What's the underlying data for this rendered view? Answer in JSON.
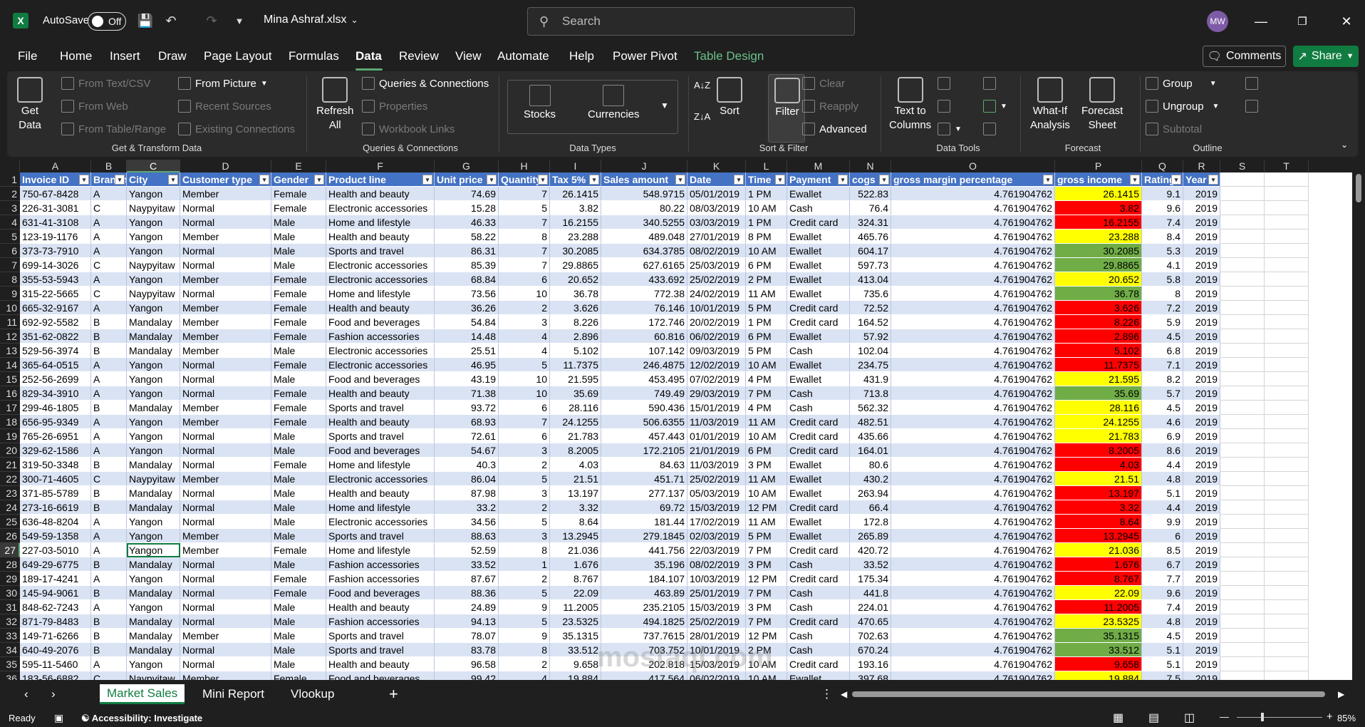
{
  "titlebar": {
    "logo": "X",
    "autosave_label": "AutoSave",
    "autosave_state": "Off",
    "filename": "Mina Ashraf.xlsx",
    "search_placeholder": "Search",
    "avatar": "MW"
  },
  "menu": [
    "File",
    "Home",
    "Insert",
    "Draw",
    "Page Layout",
    "Formulas",
    "Data",
    "Review",
    "View",
    "Automate",
    "Help",
    "Power Pivot",
    "Table Design"
  ],
  "menu_active": "Data",
  "buttons": {
    "comments": "Comments",
    "share": "Share"
  },
  "ribbon": {
    "get_data": "Get\nData",
    "from_text": "From Text/CSV",
    "from_web": "From Web",
    "from_table": "From Table/Range",
    "from_picture": "From Picture",
    "recent_sources": "Recent Sources",
    "existing_connections": "Existing Connections",
    "group_get": "Get & Transform Data",
    "refresh": "Refresh\nAll",
    "queries_connections": "Queries & Connections",
    "properties": "Properties",
    "workbook_links": "Workbook Links",
    "group_queries": "Queries & Connections",
    "stocks": "Stocks",
    "currencies": "Currencies",
    "group_datatypes": "Data Types",
    "sort": "Sort",
    "filter": "Filter",
    "clear": "Clear",
    "reapply": "Reapply",
    "advanced": "Advanced",
    "group_sortfilter": "Sort & Filter",
    "text_to_columns": "Text to\nColumns",
    "group_datatools": "Data Tools",
    "whatif": "What-If\nAnalysis",
    "forecast_sheet": "Forecast\nSheet",
    "group_forecast": "Forecast",
    "group_btn": "Group",
    "ungroup": "Ungroup",
    "subtotal": "Subtotal",
    "group_outline": "Outline"
  },
  "columns": [
    "A",
    "B",
    "C",
    "D",
    "E",
    "F",
    "G",
    "H",
    "I",
    "J",
    "K",
    "L",
    "M",
    "N",
    "O",
    "P",
    "Q",
    "R",
    "S",
    "T"
  ],
  "headers": [
    "Invoice ID",
    "Branch",
    "City",
    "Customer type",
    "Gender",
    "Product line",
    "Unit price",
    "Quantity",
    "Tax 5%",
    "Sales amount",
    "Date",
    "Time",
    "Payment",
    "cogs",
    "gross margin percentage",
    "gross income",
    "Rating",
    "Year"
  ],
  "rows": [
    [
      "750-67-8428",
      "A",
      "Yangon",
      "Member",
      "Female",
      "Health and beauty",
      "74.69",
      "7",
      "26.1415",
      "548.9715",
      "05/01/2019",
      "1 PM",
      "Ewallet",
      "522.83",
      "4.761904762",
      "26.1415",
      "9.1",
      "2019"
    ],
    [
      "226-31-3081",
      "C",
      "Naypyitaw",
      "Normal",
      "Female",
      "Electronic accessories",
      "15.28",
      "5",
      "3.82",
      "80.22",
      "08/03/2019",
      "10 AM",
      "Cash",
      "76.4",
      "4.761904762",
      "3.82",
      "9.6",
      "2019"
    ],
    [
      "631-41-3108",
      "A",
      "Yangon",
      "Normal",
      "Male",
      "Home and lifestyle",
      "46.33",
      "7",
      "16.2155",
      "340.5255",
      "03/03/2019",
      "1 PM",
      "Credit card",
      "324.31",
      "4.761904762",
      "16.2155",
      "7.4",
      "2019"
    ],
    [
      "123-19-1176",
      "A",
      "Yangon",
      "Member",
      "Male",
      "Health and beauty",
      "58.22",
      "8",
      "23.288",
      "489.048",
      "27/01/2019",
      "8 PM",
      "Ewallet",
      "465.76",
      "4.761904762",
      "23.288",
      "8.4",
      "2019"
    ],
    [
      "373-73-7910",
      "A",
      "Yangon",
      "Normal",
      "Male",
      "Sports and travel",
      "86.31",
      "7",
      "30.2085",
      "634.3785",
      "08/02/2019",
      "10 AM",
      "Ewallet",
      "604.17",
      "4.761904762",
      "30.2085",
      "5.3",
      "2019"
    ],
    [
      "699-14-3026",
      "C",
      "Naypyitaw",
      "Normal",
      "Male",
      "Electronic accessories",
      "85.39",
      "7",
      "29.8865",
      "627.6165",
      "25/03/2019",
      "6 PM",
      "Ewallet",
      "597.73",
      "4.761904762",
      "29.8865",
      "4.1",
      "2019"
    ],
    [
      "355-53-5943",
      "A",
      "Yangon",
      "Member",
      "Female",
      "Electronic accessories",
      "68.84",
      "6",
      "20.652",
      "433.692",
      "25/02/2019",
      "2 PM",
      "Ewallet",
      "413.04",
      "4.761904762",
      "20.652",
      "5.8",
      "2019"
    ],
    [
      "315-22-5665",
      "C",
      "Naypyitaw",
      "Normal",
      "Female",
      "Home and lifestyle",
      "73.56",
      "10",
      "36.78",
      "772.38",
      "24/02/2019",
      "11 AM",
      "Ewallet",
      "735.6",
      "4.761904762",
      "36.78",
      "8",
      "2019"
    ],
    [
      "665-32-9167",
      "A",
      "Yangon",
      "Member",
      "Female",
      "Health and beauty",
      "36.26",
      "2",
      "3.626",
      "76.146",
      "10/01/2019",
      "5 PM",
      "Credit card",
      "72.52",
      "4.761904762",
      "3.626",
      "7.2",
      "2019"
    ],
    [
      "692-92-5582",
      "B",
      "Mandalay",
      "Member",
      "Female",
      "Food and beverages",
      "54.84",
      "3",
      "8.226",
      "172.746",
      "20/02/2019",
      "1 PM",
      "Credit card",
      "164.52",
      "4.761904762",
      "8.226",
      "5.9",
      "2019"
    ],
    [
      "351-62-0822",
      "B",
      "Mandalay",
      "Member",
      "Female",
      "Fashion accessories",
      "14.48",
      "4",
      "2.896",
      "60.816",
      "06/02/2019",
      "6 PM",
      "Ewallet",
      "57.92",
      "4.761904762",
      "2.896",
      "4.5",
      "2019"
    ],
    [
      "529-56-3974",
      "B",
      "Mandalay",
      "Member",
      "Male",
      "Electronic accessories",
      "25.51",
      "4",
      "5.102",
      "107.142",
      "09/03/2019",
      "5 PM",
      "Cash",
      "102.04",
      "4.761904762",
      "5.102",
      "6.8",
      "2019"
    ],
    [
      "365-64-0515",
      "A",
      "Yangon",
      "Normal",
      "Female",
      "Electronic accessories",
      "46.95",
      "5",
      "11.7375",
      "246.4875",
      "12/02/2019",
      "10 AM",
      "Ewallet",
      "234.75",
      "4.761904762",
      "11.7375",
      "7.1",
      "2019"
    ],
    [
      "252-56-2699",
      "A",
      "Yangon",
      "Normal",
      "Male",
      "Food and beverages",
      "43.19",
      "10",
      "21.595",
      "453.495",
      "07/02/2019",
      "4 PM",
      "Ewallet",
      "431.9",
      "4.761904762",
      "21.595",
      "8.2",
      "2019"
    ],
    [
      "829-34-3910",
      "A",
      "Yangon",
      "Normal",
      "Female",
      "Health and beauty",
      "71.38",
      "10",
      "35.69",
      "749.49",
      "29/03/2019",
      "7 PM",
      "Cash",
      "713.8",
      "4.761904762",
      "35.69",
      "5.7",
      "2019"
    ],
    [
      "299-46-1805",
      "B",
      "Mandalay",
      "Member",
      "Female",
      "Sports and travel",
      "93.72",
      "6",
      "28.116",
      "590.436",
      "15/01/2019",
      "4 PM",
      "Cash",
      "562.32",
      "4.761904762",
      "28.116",
      "4.5",
      "2019"
    ],
    [
      "656-95-9349",
      "A",
      "Yangon",
      "Member",
      "Female",
      "Health and beauty",
      "68.93",
      "7",
      "24.1255",
      "506.6355",
      "11/03/2019",
      "11 AM",
      "Credit card",
      "482.51",
      "4.761904762",
      "24.1255",
      "4.6",
      "2019"
    ],
    [
      "765-26-6951",
      "A",
      "Yangon",
      "Normal",
      "Male",
      "Sports and travel",
      "72.61",
      "6",
      "21.783",
      "457.443",
      "01/01/2019",
      "10 AM",
      "Credit card",
      "435.66",
      "4.761904762",
      "21.783",
      "6.9",
      "2019"
    ],
    [
      "329-62-1586",
      "A",
      "Yangon",
      "Normal",
      "Male",
      "Food and beverages",
      "54.67",
      "3",
      "8.2005",
      "172.2105",
      "21/01/2019",
      "6 PM",
      "Credit card",
      "164.01",
      "4.761904762",
      "8.2005",
      "8.6",
      "2019"
    ],
    [
      "319-50-3348",
      "B",
      "Mandalay",
      "Normal",
      "Female",
      "Home and lifestyle",
      "40.3",
      "2",
      "4.03",
      "84.63",
      "11/03/2019",
      "3 PM",
      "Ewallet",
      "80.6",
      "4.761904762",
      "4.03",
      "4.4",
      "2019"
    ],
    [
      "300-71-4605",
      "C",
      "Naypyitaw",
      "Member",
      "Male",
      "Electronic accessories",
      "86.04",
      "5",
      "21.51",
      "451.71",
      "25/02/2019",
      "11 AM",
      "Ewallet",
      "430.2",
      "4.761904762",
      "21.51",
      "4.8",
      "2019"
    ],
    [
      "371-85-5789",
      "B",
      "Mandalay",
      "Normal",
      "Male",
      "Health and beauty",
      "87.98",
      "3",
      "13.197",
      "277.137",
      "05/03/2019",
      "10 AM",
      "Ewallet",
      "263.94",
      "4.761904762",
      "13.197",
      "5.1",
      "2019"
    ],
    [
      "273-16-6619",
      "B",
      "Mandalay",
      "Normal",
      "Male",
      "Home and lifestyle",
      "33.2",
      "2",
      "3.32",
      "69.72",
      "15/03/2019",
      "12 PM",
      "Credit card",
      "66.4",
      "4.761904762",
      "3.32",
      "4.4",
      "2019"
    ],
    [
      "636-48-8204",
      "A",
      "Yangon",
      "Normal",
      "Male",
      "Electronic accessories",
      "34.56",
      "5",
      "8.64",
      "181.44",
      "17/02/2019",
      "11 AM",
      "Ewallet",
      "172.8",
      "4.761904762",
      "8.64",
      "9.9",
      "2019"
    ],
    [
      "549-59-1358",
      "A",
      "Yangon",
      "Member",
      "Male",
      "Sports and travel",
      "88.63",
      "3",
      "13.2945",
      "279.1845",
      "02/03/2019",
      "5 PM",
      "Ewallet",
      "265.89",
      "4.761904762",
      "13.2945",
      "6",
      "2019"
    ],
    [
      "227-03-5010",
      "A",
      "Yangon",
      "Member",
      "Female",
      "Home and lifestyle",
      "52.59",
      "8",
      "21.036",
      "441.756",
      "22/03/2019",
      "7 PM",
      "Credit card",
      "420.72",
      "4.761904762",
      "21.036",
      "8.5",
      "2019"
    ],
    [
      "649-29-6775",
      "B",
      "Mandalay",
      "Normal",
      "Male",
      "Fashion accessories",
      "33.52",
      "1",
      "1.676",
      "35.196",
      "08/02/2019",
      "3 PM",
      "Cash",
      "33.52",
      "4.761904762",
      "1.676",
      "6.7",
      "2019"
    ],
    [
      "189-17-4241",
      "A",
      "Yangon",
      "Normal",
      "Female",
      "Fashion accessories",
      "87.67",
      "2",
      "8.767",
      "184.107",
      "10/03/2019",
      "12 PM",
      "Credit card",
      "175.34",
      "4.761904762",
      "8.767",
      "7.7",
      "2019"
    ],
    [
      "145-94-9061",
      "B",
      "Mandalay",
      "Normal",
      "Female",
      "Food and beverages",
      "88.36",
      "5",
      "22.09",
      "463.89",
      "25/01/2019",
      "7 PM",
      "Cash",
      "441.8",
      "4.761904762",
      "22.09",
      "9.6",
      "2019"
    ],
    [
      "848-62-7243",
      "A",
      "Yangon",
      "Normal",
      "Male",
      "Health and beauty",
      "24.89",
      "9",
      "11.2005",
      "235.2105",
      "15/03/2019",
      "3 PM",
      "Cash",
      "224.01",
      "4.761904762",
      "11.2005",
      "7.4",
      "2019"
    ],
    [
      "871-79-8483",
      "B",
      "Mandalay",
      "Normal",
      "Male",
      "Fashion accessories",
      "94.13",
      "5",
      "23.5325",
      "494.1825",
      "25/02/2019",
      "7 PM",
      "Credit card",
      "470.65",
      "4.761904762",
      "23.5325",
      "4.8",
      "2019"
    ],
    [
      "149-71-6266",
      "B",
      "Mandalay",
      "Member",
      "Male",
      "Sports and travel",
      "78.07",
      "9",
      "35.1315",
      "737.7615",
      "28/01/2019",
      "12 PM",
      "Cash",
      "702.63",
      "4.761904762",
      "35.1315",
      "4.5",
      "2019"
    ],
    [
      "640-49-2076",
      "B",
      "Mandalay",
      "Normal",
      "Male",
      "Sports and travel",
      "83.78",
      "8",
      "33.512",
      "703.752",
      "10/01/2019",
      "2 PM",
      "Cash",
      "670.24",
      "4.761904762",
      "33.512",
      "5.1",
      "2019"
    ],
    [
      "595-11-5460",
      "A",
      "Yangon",
      "Normal",
      "Male",
      "Health and beauty",
      "96.58",
      "2",
      "9.658",
      "202.818",
      "15/03/2019",
      "10 AM",
      "Credit card",
      "193.16",
      "4.761904762",
      "9.658",
      "5.1",
      "2019"
    ],
    [
      "183-56-6882",
      "C",
      "Naypyitaw",
      "Member",
      "Female",
      "Food and beverages",
      "99.42",
      "4",
      "19.884",
      "417.564",
      "06/02/2019",
      "10 AM",
      "Ewallet",
      "397.68",
      "4.761904762",
      "19.884",
      "7.5",
      "2019"
    ]
  ],
  "gi_colors": [
    "yellow",
    "red",
    "red",
    "yellow",
    "green",
    "green",
    "yellow",
    "green",
    "red",
    "red",
    "red",
    "red",
    "red",
    "yellow",
    "green",
    "yellow",
    "yellow",
    "yellow",
    "red",
    "red",
    "yellow",
    "red",
    "red",
    "red",
    "red",
    "yellow",
    "red",
    "red",
    "yellow",
    "red",
    "yellow",
    "green",
    "green",
    "red",
    "yellow"
  ],
  "active_cell": {
    "row": 27,
    "col": "C"
  },
  "sheets": [
    "Market Sales",
    "Mini Report",
    "Vlookup"
  ],
  "active_sheet": "Market Sales",
  "status": {
    "ready": "Ready",
    "accessibility": "Accessibility: Investigate",
    "zoom": "85%"
  },
  "watermark": "mostaql.com"
}
